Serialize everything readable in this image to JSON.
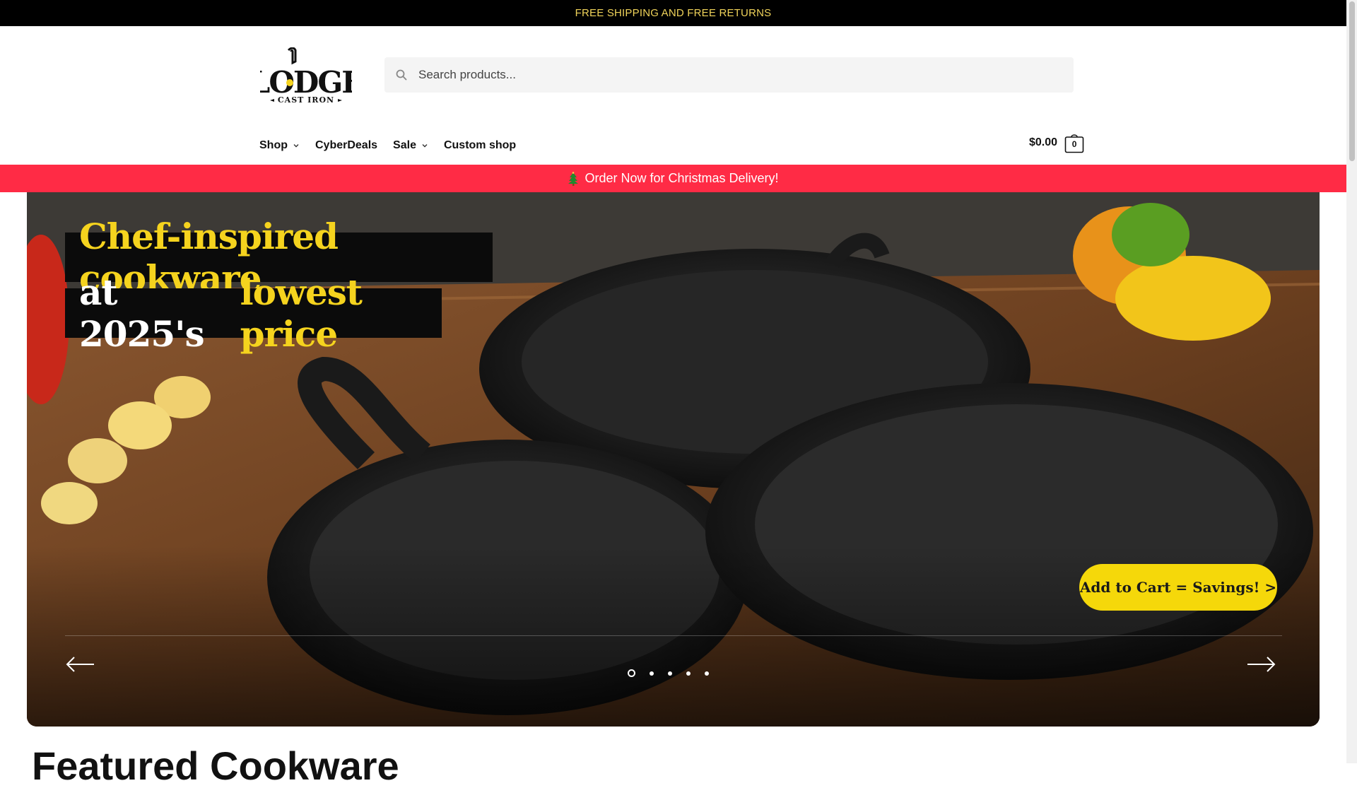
{
  "topbar": {
    "text": "FREE SHIPPING AND FREE RETURNS"
  },
  "logo": {
    "brand": "LODGE",
    "tagline": "CAST IRON"
  },
  "search": {
    "placeholder": "Search products..."
  },
  "nav": {
    "items": [
      {
        "label": "Shop",
        "has_dropdown": true
      },
      {
        "label": "CyberDeals",
        "has_dropdown": false
      },
      {
        "label": "Sale",
        "has_dropdown": true
      },
      {
        "label": "Custom shop",
        "has_dropdown": false
      }
    ]
  },
  "cart": {
    "total": "$0.00",
    "count": "0"
  },
  "promo": {
    "text": "Order Now for Christmas Delivery!",
    "icon": "christmas-tree-icon"
  },
  "hero": {
    "headline_line1": "Chef-inspired cookware",
    "headline_line2_prefix": "at 2025's",
    "headline_line2_highlight": "lowest price",
    "cta": "Add to Cart = Savings! >",
    "slide_count": 5,
    "active_slide": 1
  },
  "section": {
    "title": "Featured Cookware"
  },
  "colors": {
    "topbar_bg": "#000000",
    "topbar_text": "#f0d35a",
    "promo_bg": "#ff2b45",
    "accent_yellow": "#f5d31e",
    "cta_bg": "#f5d80a"
  }
}
